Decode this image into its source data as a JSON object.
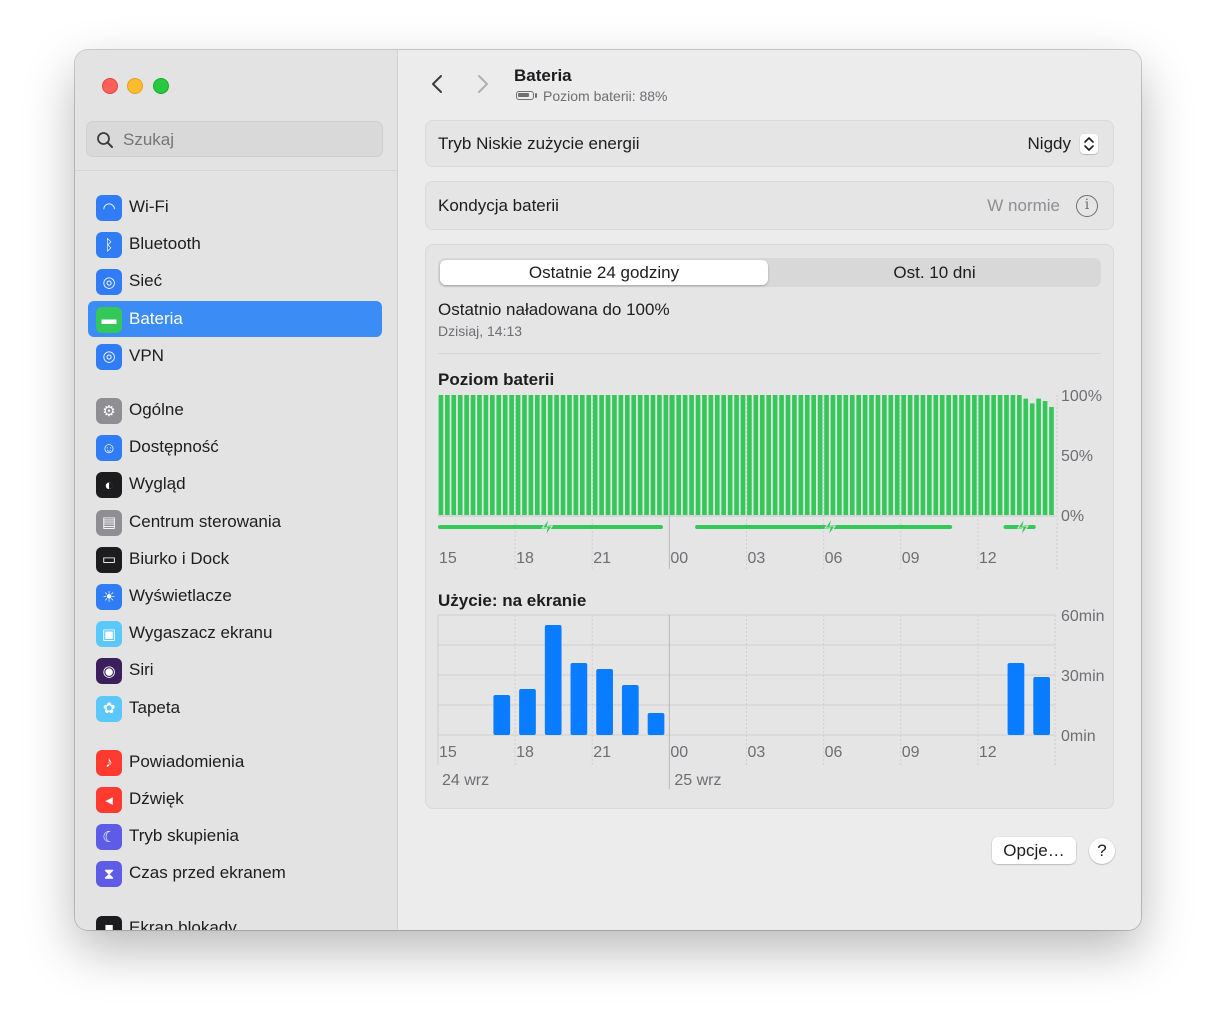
{
  "search": {
    "placeholder": "Szukaj"
  },
  "sidebar": {
    "groups": [
      [
        {
          "label": "Wi-Fi",
          "icon": "wifi-icon",
          "color": "#2f7cf6"
        },
        {
          "label": "Bluetooth",
          "icon": "bluetooth-icon",
          "color": "#2f7cf6"
        },
        {
          "label": "Sieć",
          "icon": "globe-icon",
          "color": "#2f7cf6"
        },
        {
          "label": "Bateria",
          "icon": "battery-icon",
          "color": "#34c759",
          "selected": true
        },
        {
          "label": "VPN",
          "icon": "vpn-globe-icon",
          "color": "#2f7cf6"
        }
      ],
      [
        {
          "label": "Ogólne",
          "icon": "gear-icon",
          "color": "#8e8e93"
        },
        {
          "label": "Dostępność",
          "icon": "accessibility-icon",
          "color": "#2f7cf6"
        },
        {
          "label": "Wygląd",
          "icon": "appearance-icon",
          "color": "#1c1c1e"
        },
        {
          "label": "Centrum sterowania",
          "icon": "control-center-icon",
          "color": "#8e8e93"
        },
        {
          "label": "Biurko i Dock",
          "icon": "dock-icon",
          "color": "#1c1c1e"
        },
        {
          "label": "Wyświetlacze",
          "icon": "sun-icon",
          "color": "#2f7cf6"
        },
        {
          "label": "Wygaszacz ekranu",
          "icon": "screensaver-icon",
          "color": "#5ac8fa"
        },
        {
          "label": "Siri",
          "icon": "siri-icon",
          "color": "#3a1f5c"
        },
        {
          "label": "Tapeta",
          "icon": "flower-icon",
          "color": "#5ac8fa"
        }
      ],
      [
        {
          "label": "Powiadomienia",
          "icon": "bell-icon",
          "color": "#ff3b30"
        },
        {
          "label": "Dźwięk",
          "icon": "speaker-icon",
          "color": "#ff3b30"
        },
        {
          "label": "Tryb skupienia",
          "icon": "moon-icon",
          "color": "#5e5ce6"
        },
        {
          "label": "Czas przed ekranem",
          "icon": "hourglass-icon",
          "color": "#5e5ce6"
        }
      ],
      [
        {
          "label": "Ekran blokady",
          "icon": "lock-icon",
          "color": "#1c1c1e"
        }
      ]
    ]
  },
  "header": {
    "title": "Bateria",
    "subtitle": "Poziom baterii: 88%"
  },
  "settings": {
    "low_power_label": "Tryb Niskie zużycie energii",
    "low_power_value": "Nigdy",
    "health_label": "Kondycja baterii",
    "health_value": "W normie"
  },
  "usage": {
    "tabs": [
      "Ostatnie 24 godziny",
      "Ost. 10 dni"
    ],
    "active_tab": 0,
    "last_charged": "Ostatnio naładowana do 100%",
    "last_charged_time": "Dzisiaj, 14:13"
  },
  "colors": {
    "battery_green": "#34c759",
    "usage_blue": "#0a7cff",
    "selection_blue": "#3b8cf5"
  },
  "chart_data": [
    {
      "type": "bar",
      "title": "Poziom baterii",
      "x_ticks": [
        "15",
        "18",
        "21",
        "00",
        "03",
        "06",
        "09",
        "12"
      ],
      "y_ticks": [
        "100%",
        "50%",
        "0%"
      ],
      "ylim": [
        0,
        100
      ],
      "bar_count": 96,
      "values": [
        100,
        100,
        100,
        100,
        100,
        100,
        100,
        100,
        100,
        100,
        100,
        100,
        100,
        100,
        100,
        100,
        100,
        100,
        100,
        100,
        100,
        100,
        100,
        100,
        100,
        100,
        100,
        100,
        100,
        100,
        100,
        100,
        100,
        100,
        100,
        100,
        100,
        100,
        100,
        100,
        100,
        100,
        100,
        100,
        100,
        100,
        100,
        100,
        100,
        100,
        100,
        100,
        100,
        100,
        100,
        100,
        100,
        100,
        100,
        100,
        100,
        100,
        100,
        100,
        100,
        100,
        100,
        100,
        100,
        100,
        100,
        100,
        100,
        100,
        100,
        100,
        100,
        100,
        100,
        100,
        100,
        100,
        100,
        100,
        100,
        100,
        100,
        100,
        100,
        100,
        100,
        97,
        93,
        97,
        95,
        90
      ],
      "charging_ranges": [
        [
          0,
          35
        ],
        [
          40,
          80
        ],
        [
          88,
          93
        ]
      ],
      "charge_icon_positions": [
        17,
        61,
        91
      ]
    },
    {
      "type": "bar",
      "title": "Użycie: na ekranie",
      "x_ticks": [
        "15",
        "18",
        "21",
        "00",
        "03",
        "06",
        "09",
        "12"
      ],
      "date_labels": [
        "24 wrz",
        "25 wrz"
      ],
      "y_ticks": [
        "60min",
        "30min",
        "0min"
      ],
      "ylim": [
        0,
        60
      ],
      "hour_slots": 24,
      "values": [
        0,
        0,
        20,
        23,
        55,
        36,
        33,
        25,
        11,
        0,
        0,
        0,
        0,
        0,
        0,
        0,
        0,
        0,
        0,
        0,
        0,
        0,
        36,
        29
      ]
    }
  ],
  "footer": {
    "options_label": "Opcje…",
    "help_label": "?"
  }
}
